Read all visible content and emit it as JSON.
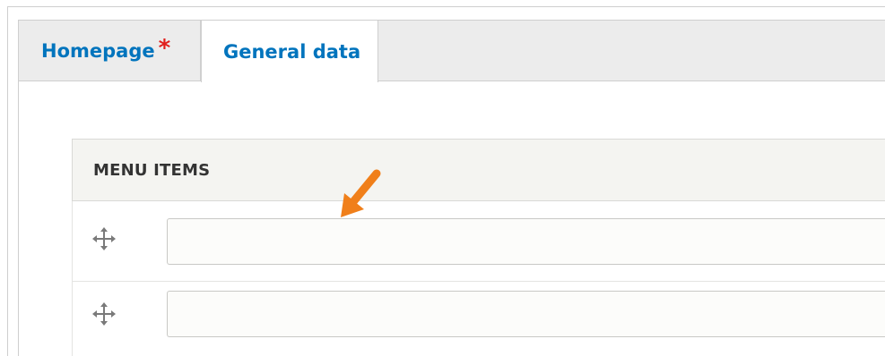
{
  "tabs": [
    {
      "label": "Homepage",
      "required_mark": "*",
      "active": false
    },
    {
      "label": "General data",
      "active": true
    }
  ],
  "menu_items": {
    "header": "MENU ITEMS",
    "rows": [
      {
        "value": "",
        "placeholder": ""
      },
      {
        "value": "",
        "placeholder": ""
      }
    ]
  },
  "colors": {
    "tab_link": "#0074bd",
    "required": "#e1201d",
    "annotation_arrow": "#f07f1a",
    "header_bg": "#f4f4f1"
  },
  "icons": {
    "drag_handle": "move-arrows-icon",
    "annotation": "orange-arrow-icon"
  }
}
